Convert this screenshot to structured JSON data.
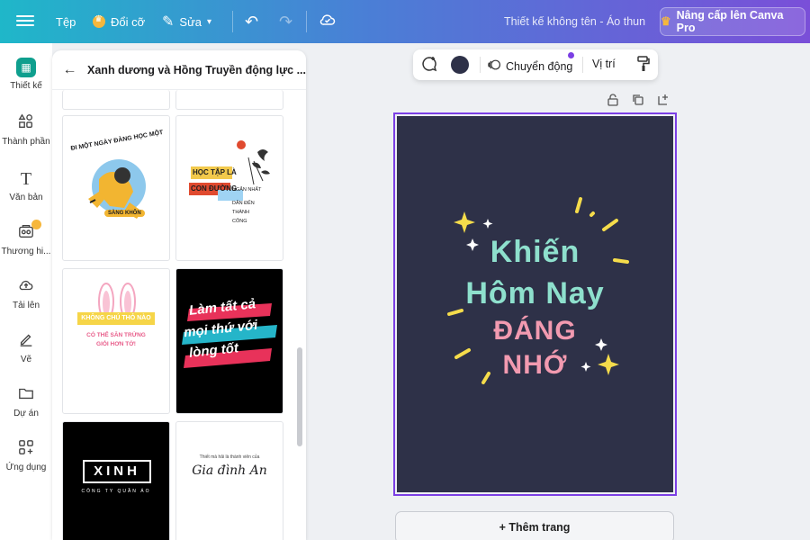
{
  "topbar": {
    "file_label": "Tệp",
    "resize_label": "Đổi cỡ",
    "edit_label": "Sửa",
    "doc_title": "Thiết kế không tên - Áo thun",
    "upgrade_label": "Nâng cấp lên Canva Pro"
  },
  "rail": {
    "items": [
      {
        "label": "Thiết kế",
        "icon": "design-icon"
      },
      {
        "label": "Thành phần",
        "icon": "elements-icon"
      },
      {
        "label": "Văn bản",
        "icon": "text-icon"
      },
      {
        "label": "Thương hi...",
        "icon": "brand-icon"
      },
      {
        "label": "Tải lên",
        "icon": "upload-icon"
      },
      {
        "label": "Vẽ",
        "icon": "draw-icon"
      },
      {
        "label": "Dự án",
        "icon": "folder-icon"
      },
      {
        "label": "Ứng dụng",
        "icon": "apps-icon"
      }
    ]
  },
  "panel": {
    "title": "Xanh dương và Hồng Truyền động lực ...",
    "templates": [
      {
        "lines": [
          "ĐI MỘT NGÀY ĐÀNG HỌC MỘT",
          "SÀNG KHÔN"
        ]
      },
      {
        "lines": [
          "HỌC TẬP LÀ",
          "CON ĐƯỜNG",
          "NGẮN NHẤT",
          "DẪN ĐẾN",
          "THÀNH",
          "CÔNG"
        ]
      },
      {
        "lines": [
          "KHÔNG CHÚ THỎ NÀO",
          "CÓ THỂ SĂN TRỨNG",
          "GIỎI HƠN TỚ!"
        ]
      },
      {
        "lines": [
          "Làm tất cả",
          "mọi thứ với",
          "lòng tốt"
        ]
      },
      {
        "lines": [
          "XINH",
          "CÔNG TY QUẦN ÁO"
        ]
      },
      {
        "lines": [
          "Thiết mà hãi là thành viên của",
          "Gia đình An"
        ]
      }
    ]
  },
  "toolbar": {
    "motion_label": "Chuyển động",
    "position_label": "Vị trí",
    "swatch_color": "#2e3148"
  },
  "design": {
    "line1": "Khiến",
    "line2": "Hôm Nay",
    "line3": "ĐÁNG",
    "line4": "NHỚ",
    "bg_color": "#2e3148",
    "teal": "#8ee0cd",
    "pink": "#f29ab0",
    "yellow": "#f5dc4b"
  },
  "add_page_label": "+ Thêm trang"
}
